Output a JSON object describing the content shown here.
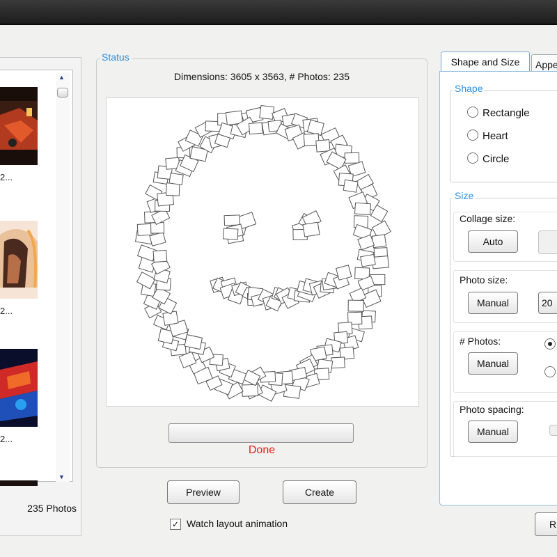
{
  "photo_list": {
    "items": [
      {
        "caption": "2..."
      },
      {
        "caption": "2..."
      },
      {
        "caption": "2..."
      }
    ],
    "count_label": "235 Photos"
  },
  "status": {
    "legend": "Status",
    "dimensions": "Dimensions: 3605 x 3563, # Photos: 235",
    "progress_fraction": 0,
    "state_text": "Done"
  },
  "actions": {
    "preview_label": "Preview",
    "create_label": "Create",
    "watch_animation_label": "Watch layout animation",
    "watch_animation_checked": true,
    "right_cut_button": "R"
  },
  "tabs": [
    {
      "label": "Shape and Size",
      "active": true
    },
    {
      "label": "Appe",
      "active": false
    }
  ],
  "shape": {
    "legend": "Shape",
    "options": [
      "Rectangle",
      "Heart",
      "Circle"
    ]
  },
  "size": {
    "legend": "Size",
    "collage_size_label": "Collage size:",
    "collage_size_mode": "Auto",
    "photo_size_label": "Photo size:",
    "photo_size_mode": "Manual",
    "photo_size_value": "20",
    "photos_label": "# Photos:",
    "photos_mode": "Manual",
    "photo_spacing_label": "Photo spacing:",
    "photo_spacing_mode": "Manual"
  },
  "colors": {
    "accent": "#2f8fe0",
    "done": "#e81b1b"
  }
}
